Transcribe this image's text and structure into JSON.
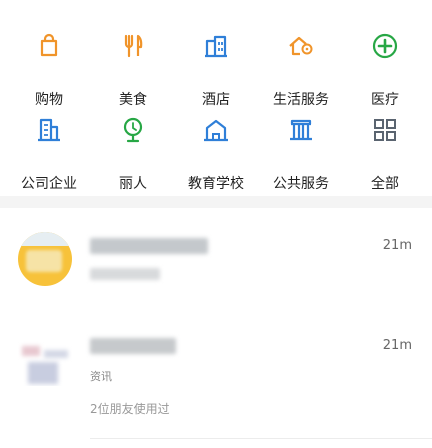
{
  "theme": {
    "icon_green": "#27a745",
    "icon_orange": "#f0942a",
    "icon_blue": "#2f7fd8"
  },
  "categories": [
    {
      "label": "购物",
      "icon": "bag-icon",
      "color": "#f0942a"
    },
    {
      "label": "美食",
      "icon": "fork-knife-icon",
      "color": "#f0942a"
    },
    {
      "label": "酒店",
      "icon": "hotel-building-icon",
      "color": "#2f7fd8"
    },
    {
      "label": "生活服务",
      "icon": "home-pin-icon",
      "color": "#f0942a"
    },
    {
      "label": "医疗",
      "icon": "medical-plus-icon",
      "color": "#27a745"
    },
    {
      "label": "公司企业",
      "icon": "company-icon",
      "color": "#2f7fd8"
    },
    {
      "label": "丽人",
      "icon": "mirror-icon",
      "color": "#27a745"
    },
    {
      "label": "教育学校",
      "icon": "school-icon",
      "color": "#2f7fd8"
    },
    {
      "label": "公共服务",
      "icon": "public-building-icon",
      "color": "#2f7fd8"
    },
    {
      "label": "全部",
      "icon": "all-grid-icon",
      "color": "#5a6470"
    }
  ],
  "feed": [
    {
      "distance": "21m",
      "subtitle": "...与推荐",
      "friends": ""
    },
    {
      "distance": "21m",
      "subtitle": "资讯",
      "friends": "2位朋友使用过"
    }
  ]
}
